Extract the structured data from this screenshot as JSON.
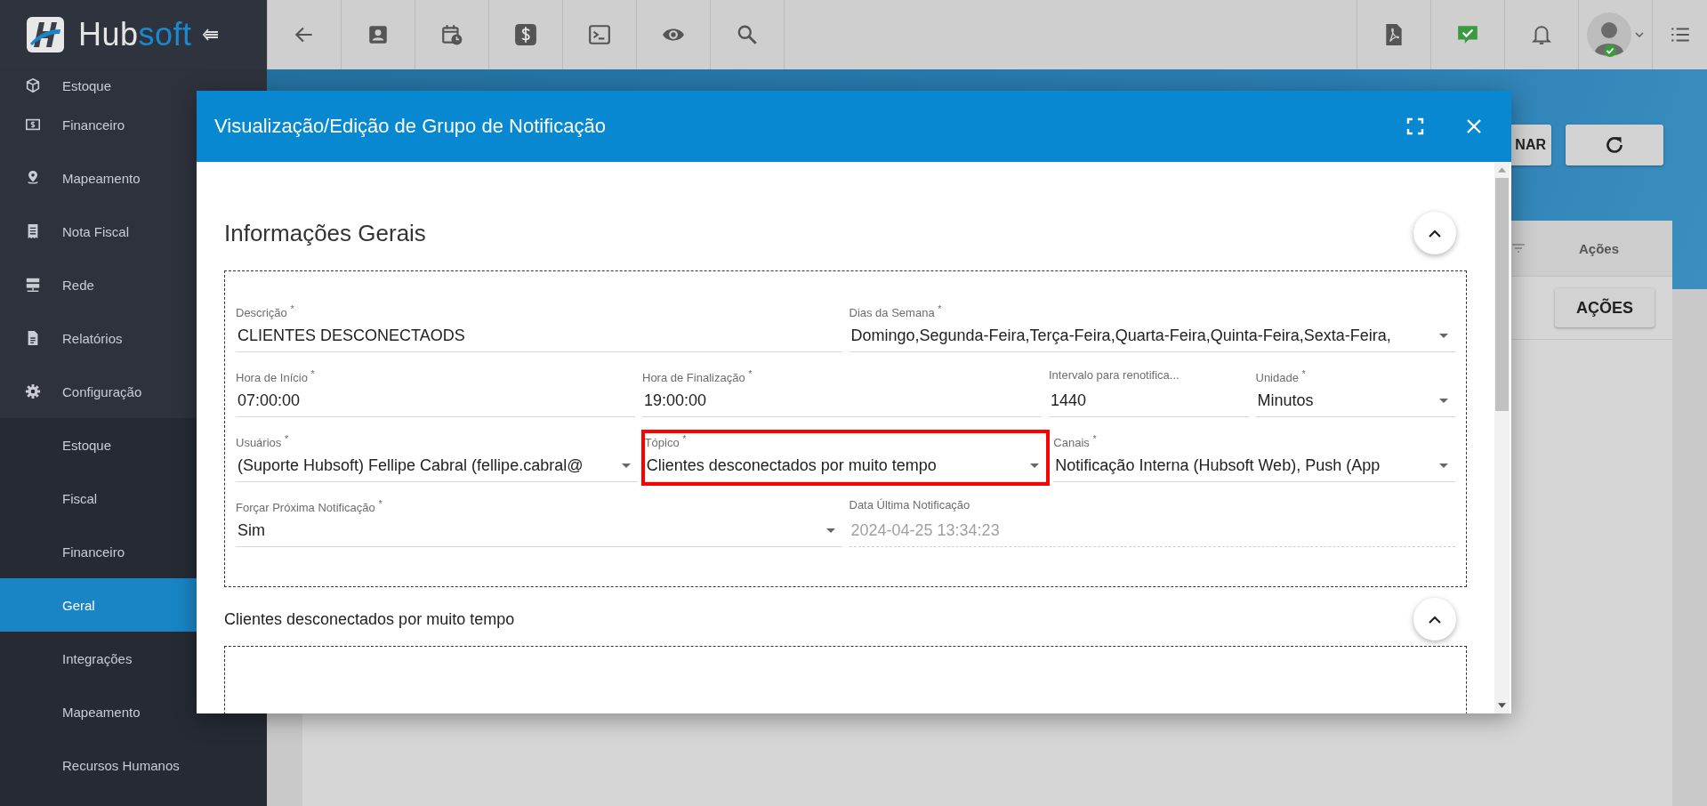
{
  "logo": {
    "first": "Hub",
    "second": "soft"
  },
  "sidebar": {
    "items": [
      {
        "label": "Estoque",
        "selected": false
      },
      {
        "label": "Financeiro",
        "selected": false
      },
      {
        "label": "Mapeamento",
        "selected": false
      },
      {
        "label": "Nota Fiscal",
        "selected": false
      },
      {
        "label": "Rede",
        "selected": false
      },
      {
        "label": "Relatórios",
        "selected": false
      },
      {
        "label": "Configuração",
        "selected": false,
        "expanded": true,
        "children": [
          {
            "label": "Estoque",
            "selected": false
          },
          {
            "label": "Fiscal",
            "selected": false
          },
          {
            "label": "Financeiro",
            "selected": false
          },
          {
            "label": "Geral",
            "selected": true
          },
          {
            "label": "Integrações",
            "selected": false
          },
          {
            "label": "Mapeamento",
            "selected": false
          },
          {
            "label": "Recursos Humanos",
            "selected": false
          }
        ]
      }
    ]
  },
  "page": {
    "toolbar_button": "NAR",
    "table": {
      "columns": [
        "Ações"
      ],
      "rows": [
        {
          "action": "AÇÕES"
        }
      ]
    }
  },
  "modal": {
    "title": "Visualização/Edição de Grupo de Notificação",
    "sections": [
      {
        "title": "Informações Gerais",
        "expanded": true,
        "rows": [
          [
            {
              "label": "Descrição $^{*}$",
              "value": "CLIENTES DESCONECTAODS",
              "kind": "text",
              "disabled": false,
              "highlighted": false
            },
            {
              "label": "Dias da Semana $^{*}$",
              "value": "Domingo,Segunda-Feira,Terça-Feira,Quarta-Feira,Quinta-Feira,Sexta-Feira,",
              "kind": "select",
              "disabled": false,
              "highlighted": false
            }
          ],
          [
            {
              "label": "Hora de Início $^{*}$",
              "value": "07:00:00",
              "kind": "text",
              "disabled": false,
              "highlighted": false
            },
            {
              "label": "Hora de Finalização $^{*}$",
              "value": "19:00:00",
              "kind": "text",
              "disabled": false,
              "highlighted": false
            },
            {
              "label": "Intervalo para renotifica...",
              "value": "1440",
              "kind": "text",
              "disabled": false,
              "highlighted": false
            },
            {
              "label": "Unidade $^{*}$",
              "value": "Minutos",
              "kind": "select",
              "disabled": false,
              "highlighted": false
            }
          ],
          [
            {
              "label": "Usuários $^{*}$",
              "value": "(Suporte Hubsoft) Fellipe Cabral (fellipe.cabral@",
              "kind": "select",
              "disabled": false,
              "highlighted": false
            },
            {
              "label": "Tópico $^{*}$",
              "value": "Clientes desconectados por muito tempo",
              "kind": "select",
              "disabled": false,
              "highlighted": true
            },
            {
              "label": "Canais $^{*}$",
              "value": "Notificação Interna (Hubsoft Web), Push (App",
              "kind": "select",
              "disabled": false,
              "highlighted": false
            }
          ],
          [
            {
              "label": "Forçar Próxima Notificação $^{*}$",
              "value": "Sim",
              "kind": "select",
              "disabled": false,
              "highlighted": false
            },
            {
              "label": "Data Última Notificação",
              "value": "2024-04-25 13:34:23",
              "kind": "text",
              "disabled": true,
              "highlighted": false
            }
          ]
        ]
      },
      {
        "title": "Clientes desconectados por muito tempo",
        "expanded": true
      }
    ]
  }
}
